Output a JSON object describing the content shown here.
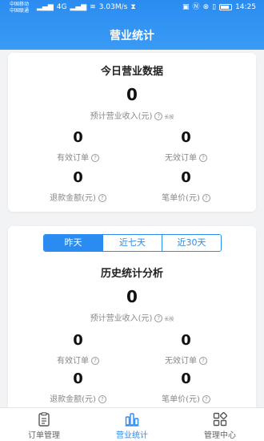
{
  "status_bar": {
    "carrier1": "中国移动",
    "carrier2": "中国联通",
    "network": "4G",
    "speed": "3.03M/s",
    "battery": "",
    "time": "14:25"
  },
  "page_title": "营业统计",
  "today": {
    "title": "今日营业数据",
    "revenue_value": "0",
    "revenue_label": "预计营业收入(元)",
    "revenue_tip": "长按",
    "stats": [
      {
        "value": "0",
        "label": "有效订单"
      },
      {
        "value": "0",
        "label": "无效订单"
      },
      {
        "value": "0",
        "label": "退款金额(元)"
      },
      {
        "value": "0",
        "label": "笔单价(元)"
      }
    ]
  },
  "history": {
    "tabs": [
      "昨天",
      "近七天",
      "近30天"
    ],
    "active_tab": 0,
    "title": "历史统计分析",
    "revenue_value": "0",
    "revenue_label": "预计营业收入(元)",
    "revenue_tip": "长按",
    "stats": [
      {
        "value": "0",
        "label": "有效订单"
      },
      {
        "value": "0",
        "label": "无效订单"
      },
      {
        "value": "0",
        "label": "退款金额(元)"
      },
      {
        "value": "0",
        "label": "笔单价(元)"
      }
    ]
  },
  "bottom_nav": [
    {
      "label": "订单管理",
      "icon": "clipboard-icon",
      "active": false
    },
    {
      "label": "营业统计",
      "icon": "bar-chart-icon",
      "active": true
    },
    {
      "label": "管理中心",
      "icon": "grid-icon",
      "active": false
    }
  ],
  "colors": {
    "accent": "#2a8cf0",
    "background": "#f2f3f5"
  }
}
